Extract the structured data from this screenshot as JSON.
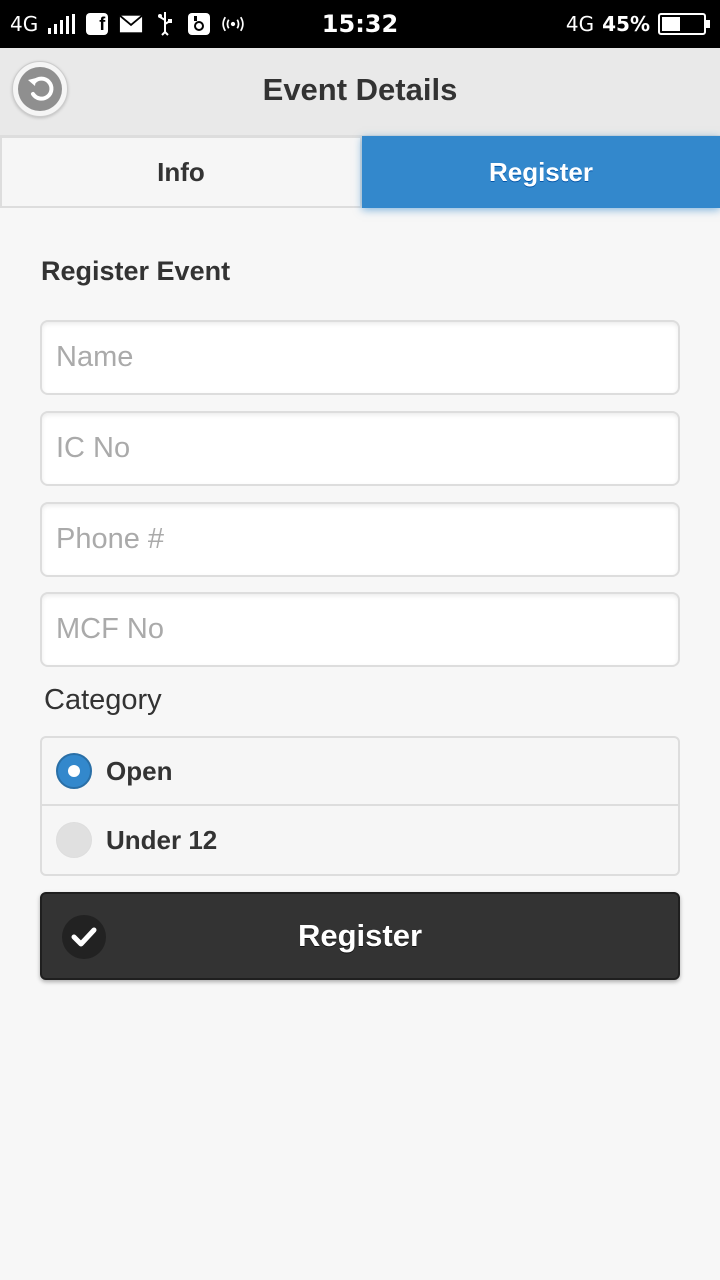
{
  "status_bar": {
    "network_left": "4G",
    "time": "15:32",
    "network_right": "4G",
    "battery": "45%",
    "battery_level": 0.45
  },
  "header": {
    "title": "Event Details",
    "back_icon": "back-arrow-icon"
  },
  "tabs": [
    {
      "label": "Info",
      "active": false
    },
    {
      "label": "Register",
      "active": true
    }
  ],
  "form": {
    "title": "Register Event",
    "fields": [
      {
        "placeholder": "Name",
        "value": ""
      },
      {
        "placeholder": "IC No",
        "value": ""
      },
      {
        "placeholder": "Phone #",
        "value": ""
      },
      {
        "placeholder": "MCF No",
        "value": ""
      }
    ],
    "category": {
      "label": "Category",
      "options": [
        {
          "label": "Open",
          "selected": true
        },
        {
          "label": "Under 12",
          "selected": false
        }
      ]
    },
    "submit": {
      "label": "Register",
      "icon": "check-icon"
    }
  },
  "colors": {
    "accent": "#3388cc",
    "button_dark": "#333333"
  }
}
